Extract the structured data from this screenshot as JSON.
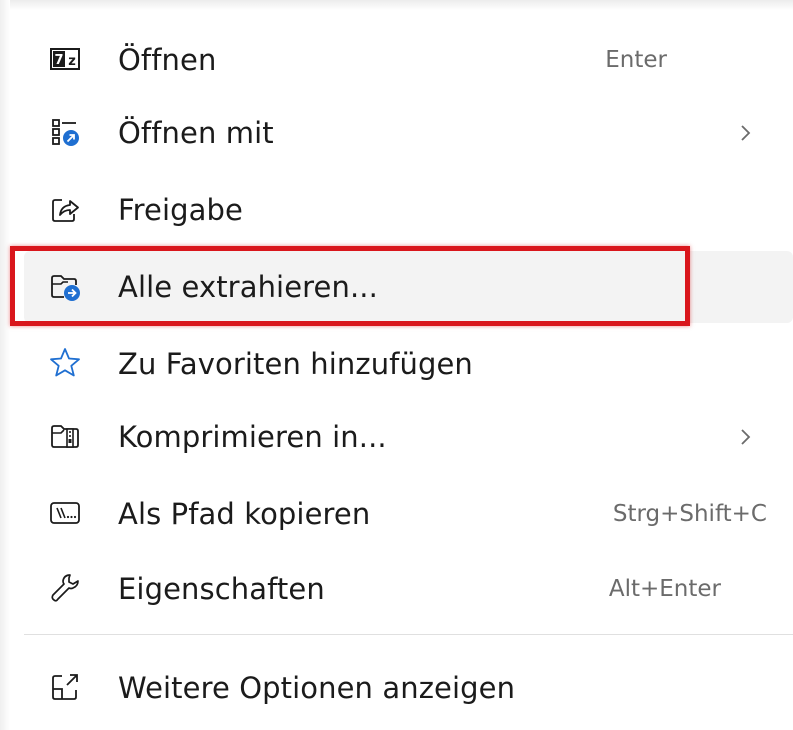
{
  "menu": {
    "items": [
      {
        "label": "Öffnen",
        "shortcut": "Enter",
        "icon": "7zip-icon",
        "submenu": false
      },
      {
        "label": "Öffnen mit",
        "shortcut": "",
        "icon": "open-with-icon",
        "submenu": true
      },
      {
        "label": "Freigabe",
        "shortcut": "",
        "icon": "share-icon",
        "submenu": false
      },
      {
        "label": "Alle extrahieren...",
        "shortcut": "",
        "icon": "extract-folder-icon",
        "submenu": false,
        "highlighted": true
      },
      {
        "label": "Zu Favoriten hinzufügen",
        "shortcut": "",
        "icon": "star-icon",
        "submenu": false
      },
      {
        "label": "Komprimieren in...",
        "shortcut": "",
        "icon": "zip-folder-icon",
        "submenu": true
      },
      {
        "label": "Als Pfad kopieren",
        "shortcut": "Strg+Shift+C",
        "icon": "copy-path-icon",
        "submenu": false
      },
      {
        "label": "Eigenschaften",
        "shortcut": "Alt+Enter",
        "icon": "wrench-icon",
        "submenu": false
      }
    ],
    "more_options": {
      "label": "Weitere Optionen anzeigen",
      "icon": "more-options-icon"
    }
  },
  "colors": {
    "highlight_border": "#d9161c",
    "accent_blue": "#1f6fd1",
    "text": "#1b1b1b",
    "shortcut_text": "#6b6b6b"
  }
}
